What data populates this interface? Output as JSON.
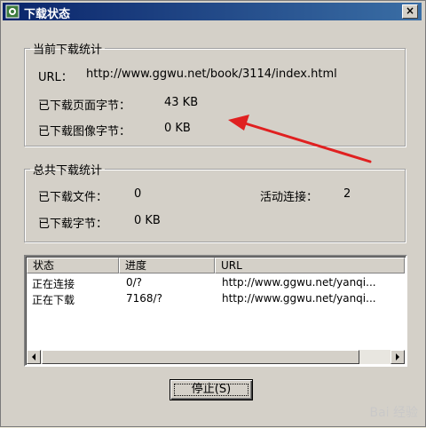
{
  "window": {
    "title": "下载状态",
    "close_glyph": "×"
  },
  "current_stats": {
    "legend": "当前下载统计",
    "url_label": "URL：",
    "url_value": "http://www.ggwu.net/book/3114/index.html",
    "page_bytes_label": "已下载页面字节：",
    "page_bytes_value": "43 KB",
    "image_bytes_label": "已下载图像字节：",
    "image_bytes_value": "0 KB"
  },
  "total_stats": {
    "legend": "总共下载统计",
    "files_label": "已下载文件：",
    "files_value": "0",
    "active_conn_label": "活动连接：",
    "active_conn_value": "2",
    "bytes_label": "已下载字节：",
    "bytes_value": "0 KB"
  },
  "list": {
    "columns": [
      "状态",
      "进度",
      "URL"
    ],
    "rows": [
      {
        "status": "正在连接",
        "progress": "0/?",
        "url": "http://www.ggwu.net/yanqi..."
      },
      {
        "status": "正在下载",
        "progress": "7168/?",
        "url": "http://www.ggwu.net/yanqi..."
      }
    ]
  },
  "buttons": {
    "stop": "停止(S)"
  },
  "annotation": {
    "arrow_color": "#e02020"
  },
  "watermark": "Bai 经验"
}
